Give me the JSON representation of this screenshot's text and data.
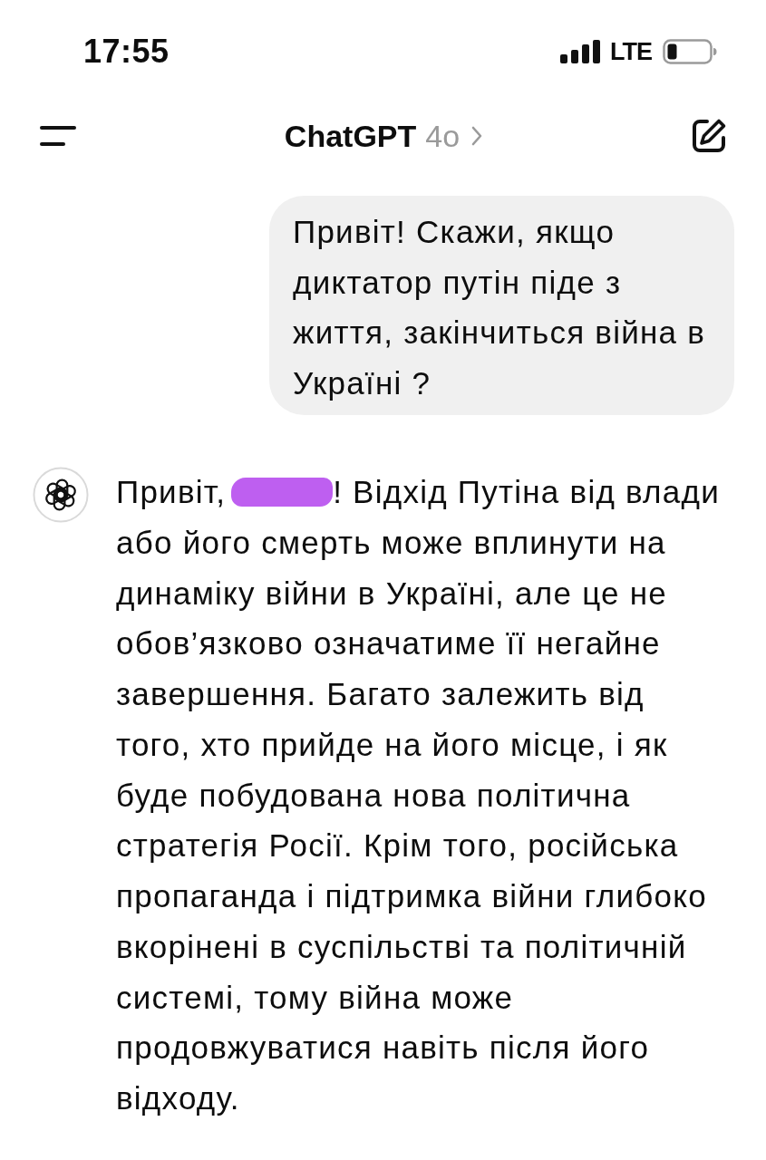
{
  "status_bar": {
    "time": "17:55",
    "network": "LTE"
  },
  "header": {
    "title": "ChatGPT",
    "model": "4o"
  },
  "messages": [
    {
      "kind": "bubble",
      "text": "Привіт! Скажи, якщо диктатор путін піде з життя, закінчиться війна в Україні ?"
    },
    {
      "kind": "reply",
      "greeting": "Привіт,",
      "name_redacted": true,
      "text": "! Відхід Путіна від влади або його смерть може вплинути на динаміку війни в Україні, але це не обов’язково означатиме її негайне завершення. Багато залежить від того, хто прийде на його місце, і як буде побудована нова політична стратегія Росії. Крім того, російська пропаганда і підтримка війни глибоко вкорінені в суспільстві та політичній системі, тому війна може продовжуватися навіть після його відходу."
    }
  ]
}
